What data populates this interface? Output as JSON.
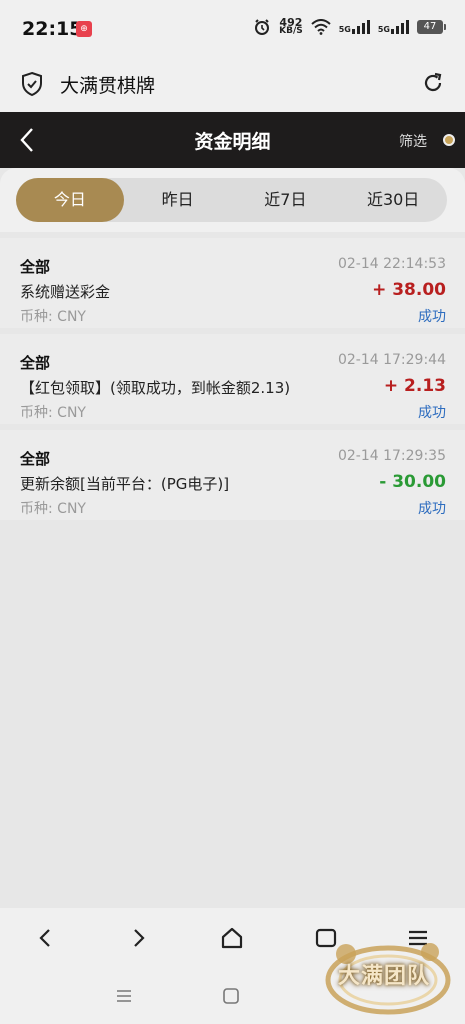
{
  "status_bar": {
    "time": "22:15",
    "badge": "⊕",
    "net_speed": "492",
    "net_unit": "KB/S",
    "sig1": "5G",
    "sig2": "5G",
    "battery": "47"
  },
  "app": {
    "title": "大满贯棋牌"
  },
  "navbar": {
    "title": "资金明细",
    "filter_label": "筛选"
  },
  "tabs": [
    {
      "label": "今日",
      "active": true
    },
    {
      "label": "昨日",
      "active": false
    },
    {
      "label": "近7日",
      "active": false
    },
    {
      "label": "近30日",
      "active": false
    }
  ],
  "records": [
    {
      "category": "全部",
      "time": "02-14 22:14:53",
      "description": "系统赠送彩金",
      "amount": "+ 38.00",
      "sign": "pos",
      "currency": "币种: CNY",
      "status": "成功"
    },
    {
      "category": "全部",
      "time": "02-14 17:29:44",
      "description": "【红包领取】(领取成功，到帐金额2.13)",
      "amount": "+ 2.13",
      "sign": "pos",
      "currency": "币种: CNY",
      "status": "成功"
    },
    {
      "category": "全部",
      "time": "02-14 17:29:35",
      "description": "更新余额[当前平台：(PG电子)]",
      "amount": "- 30.00",
      "sign": "neg",
      "currency": "币种: CNY",
      "status": "成功"
    }
  ],
  "watermark": {
    "text": "大满团队"
  },
  "colors": {
    "accent_gold": "#a88a52",
    "positive_red": "#b81f1f",
    "negative_green": "#2a9a35",
    "status_blue": "#2e6dbf",
    "header_dark": "#1e1c1c"
  }
}
